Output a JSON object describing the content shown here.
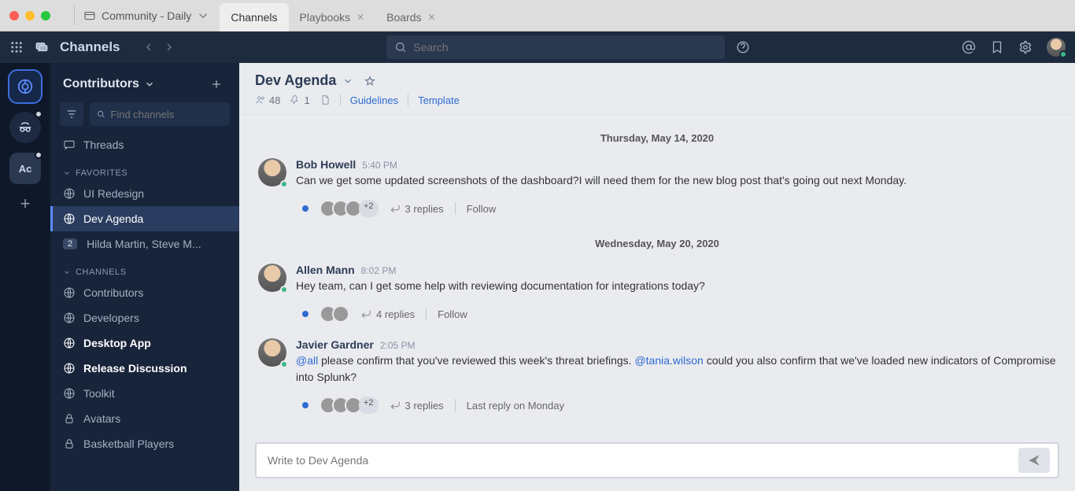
{
  "titlebar": {
    "workspace": "Community - Daily",
    "tabs": [
      {
        "label": "Channels",
        "active": true,
        "closable": false
      },
      {
        "label": "Playbooks",
        "active": false,
        "closable": true
      },
      {
        "label": "Boards",
        "active": false,
        "closable": true
      }
    ]
  },
  "header": {
    "title": "Channels",
    "search_placeholder": "Search"
  },
  "server_rail": {
    "items": [
      {
        "kind": "logo",
        "active": true
      },
      {
        "kind": "icon-anon"
      },
      {
        "kind": "text",
        "label": "Ac"
      }
    ]
  },
  "sidebar": {
    "team_name": "Contributors",
    "find_placeholder": "Find channels",
    "threads_label": "Threads",
    "categories": [
      {
        "name": "FAVORITES",
        "items": [
          {
            "icon": "globe",
            "label": "UI Redesign"
          },
          {
            "icon": "globe",
            "label": "Dev Agenda",
            "active": true
          },
          {
            "icon": "badge",
            "badge": "2",
            "label": "Hilda Martin, Steve M..."
          }
        ]
      },
      {
        "name": "CHANNELS",
        "items": [
          {
            "icon": "globe",
            "label": "Contributors"
          },
          {
            "icon": "globe",
            "label": "Developers"
          },
          {
            "icon": "globe",
            "label": "Desktop App",
            "bold": true
          },
          {
            "icon": "globe",
            "label": "Release Discussion",
            "bold": true
          },
          {
            "icon": "globe",
            "label": "Toolkit"
          },
          {
            "icon": "lock",
            "label": "Avatars"
          },
          {
            "icon": "lock",
            "label": "Basketball Players"
          }
        ]
      }
    ]
  },
  "channel": {
    "name": "Dev Agenda",
    "members": "48",
    "pinned": "1",
    "links": [
      "Guidelines",
      "Template"
    ],
    "composer_placeholder": "Write to Dev Agenda"
  },
  "messages": [
    {
      "type": "date",
      "label": "Thursday, May 14, 2020"
    },
    {
      "type": "msg",
      "author": "Bob Howell",
      "time": "5:40 PM",
      "text": "Can we get some updated screenshots of the dashboard?I will need them for the new blog post that's going out next Monday.",
      "thread": {
        "unread": true,
        "avatars": 3,
        "plus": "+2",
        "replies": "3 replies",
        "follow": "Follow"
      }
    },
    {
      "type": "date",
      "label": "Wednesday, May 20, 2020"
    },
    {
      "type": "msg",
      "author": "Allen Mann",
      "time": "8:02 PM",
      "text": "Hey team, can I get some help with reviewing documentation for integrations today?",
      "thread": {
        "unread": true,
        "avatars": 2,
        "replies": "4 replies",
        "follow": "Follow"
      }
    },
    {
      "type": "msg",
      "author": "Javier Gardner",
      "time": "2:05 PM",
      "segments": [
        {
          "mention": "@all"
        },
        {
          "text": " please confirm that you've reviewed this week's threat briefings. "
        },
        {
          "mention": "@tania.wilson"
        },
        {
          "text": " could you also confirm that we've loaded new indicators of Compromise into Splunk?"
        }
      ],
      "thread": {
        "unread": true,
        "avatars": 3,
        "plus": "+2",
        "replies": "3 replies",
        "last": "Last reply on Monday"
      }
    }
  ]
}
